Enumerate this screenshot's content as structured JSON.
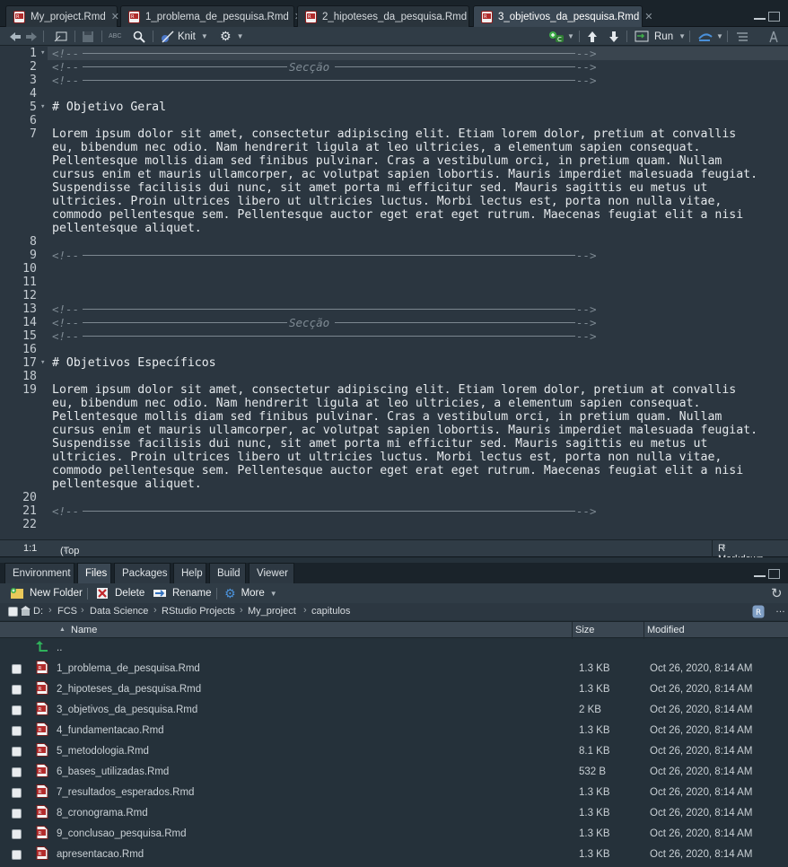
{
  "editor": {
    "tabs": [
      {
        "label": "My_project.Rmd"
      },
      {
        "label": "1_problema_de_pesquisa.Rmd"
      },
      {
        "label": "2_hipoteses_da_pesquisa.Rmd"
      },
      {
        "label": "3_objetivos_da_pesquisa.Rmd"
      }
    ],
    "toolbar": {
      "abc_label": "ABC",
      "knit_label": "Knit",
      "run_label": "Run"
    },
    "section_label": "Secção",
    "comment_open": "<!--",
    "arrow_close": "-->",
    "lines": {
      "l5": "# Objetivo Geral",
      "l7": [
        "Lorem ipsum dolor sit amet, consectetur adipiscing elit. Etiam lorem dolor, pretium at convallis",
        "eu, bibendum nec odio. Nam hendrerit ligula at leo ultricies, a elementum sapien consequat.",
        "Pellentesque mollis diam sed finibus pulvinar. Cras a vestibulum orci, in pretium quam. Nullam",
        "cursus enim et mauris ullamcorper, ac volutpat sapien lobortis. Mauris imperdiet malesuada feugiat.",
        "Suspendisse facilisis dui nunc, sit amet porta mi efficitur sed. Mauris sagittis eu metus ut",
        "ultricies. Proin ultrices libero ut ultricies luctus. Morbi lectus est, porta non nulla vitae,",
        "commodo pellentesque sem. Pellentesque auctor eget erat eget rutrum. Maecenas feugiat elit a nisi",
        "pellentesque aliquet."
      ],
      "l17": "# Objetivos Específicos",
      "l19": [
        "Lorem ipsum dolor sit amet, consectetur adipiscing elit. Etiam lorem dolor, pretium at convallis",
        "eu, bibendum nec odio. Nam hendrerit ligula at leo ultricies, a elementum sapien consequat.",
        "Pellentesque mollis diam sed finibus pulvinar. Cras a vestibulum orci, in pretium quam. Nullam",
        "cursus enim et mauris ullamcorper, ac volutpat sapien lobortis. Mauris imperdiet malesuada feugiat.",
        "Suspendisse facilisis dui nunc, sit amet porta mi efficitur sed. Mauris sagittis eu metus ut",
        "ultricies. Proin ultrices libero ut ultricies luctus. Morbi lectus est, porta non nulla vitae,",
        "commodo pellentesque sem. Pellentesque auctor eget erat eget rutrum. Maecenas feugiat elit a nisi",
        "pellentesque aliquet."
      ]
    },
    "line_numbers": [
      "1",
      "2",
      "3",
      "4",
      "5",
      "6",
      "7",
      "8",
      "9",
      "10",
      "11",
      "12",
      "13",
      "14",
      "15",
      "16",
      "17",
      "18",
      "19",
      "20",
      "21",
      "22"
    ],
    "status": {
      "position": "1:1",
      "scope": "(Top Level)",
      "mode": "R Markdown"
    }
  },
  "files_pane": {
    "tabs": [
      "Environment",
      "Files",
      "Packages",
      "Help",
      "Build",
      "Viewer"
    ],
    "active_tab": "Files",
    "toolbar": {
      "new_folder": "New Folder",
      "delete": "Delete",
      "rename": "Rename",
      "more": "More"
    },
    "path": [
      "D:",
      "FCS",
      "Data Science",
      "RStudio Projects",
      "My_project",
      "capitulos"
    ],
    "columns": {
      "name": "Name",
      "size": "Size",
      "modified": "Modified"
    },
    "parent_dir": "..",
    "files": [
      {
        "name": "1_problema_de_pesquisa.Rmd",
        "size": "1.3 KB",
        "modified": "Oct 26, 2020, 8:14 AM"
      },
      {
        "name": "2_hipoteses_da_pesquisa.Rmd",
        "size": "1.3 KB",
        "modified": "Oct 26, 2020, 8:14 AM"
      },
      {
        "name": "3_objetivos_da_pesquisa.Rmd",
        "size": "2 KB",
        "modified": "Oct 26, 2020, 8:14 AM"
      },
      {
        "name": "4_fundamentacao.Rmd",
        "size": "1.3 KB",
        "modified": "Oct 26, 2020, 8:14 AM"
      },
      {
        "name": "5_metodologia.Rmd",
        "size": "8.1 KB",
        "modified": "Oct 26, 2020, 8:14 AM"
      },
      {
        "name": "6_bases_utilizadas.Rmd",
        "size": "532 B",
        "modified": "Oct 26, 2020, 8:14 AM"
      },
      {
        "name": "7_resultados_esperados.Rmd",
        "size": "1.3 KB",
        "modified": "Oct 26, 2020, 8:14 AM"
      },
      {
        "name": "8_cronograma.Rmd",
        "size": "1.3 KB",
        "modified": "Oct 26, 2020, 8:14 AM"
      },
      {
        "name": "9_conclusao_pesquisa.Rmd",
        "size": "1.3 KB",
        "modified": "Oct 26, 2020, 8:14 AM"
      },
      {
        "name": "apresentacao.Rmd",
        "size": "1.3 KB",
        "modified": "Oct 26, 2020, 8:14 AM"
      }
    ]
  }
}
